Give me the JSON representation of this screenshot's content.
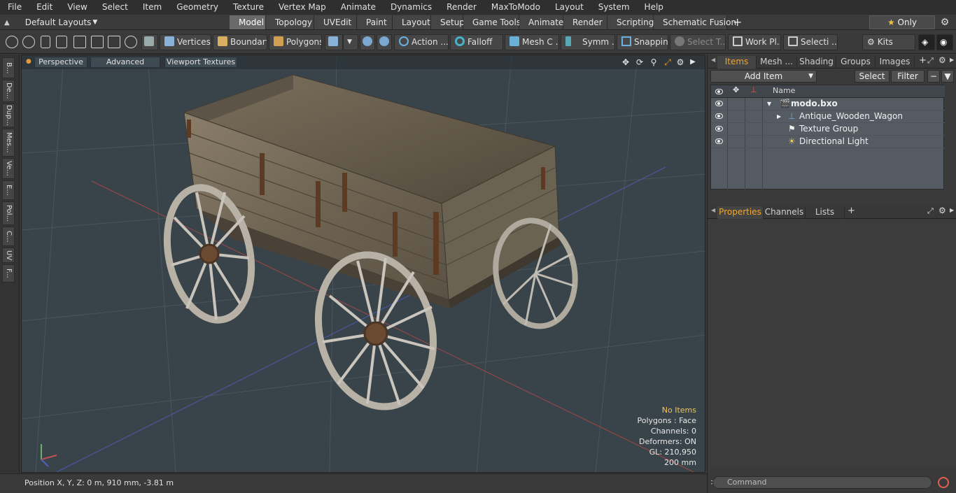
{
  "menu": [
    "File",
    "Edit",
    "View",
    "Select",
    "Item",
    "Geometry",
    "Texture",
    "Vertex Map",
    "Animate",
    "Dynamics",
    "Render",
    "MaxToModo",
    "Layout",
    "System",
    "Help"
  ],
  "layouts_label": "Default Layouts",
  "tabs": [
    "Model",
    "Topology",
    "UVEdit",
    "Paint",
    "Layout",
    "Setup",
    "Game Tools",
    "Animate",
    "Render",
    "Scripting",
    "Schematic Fusion"
  ],
  "tab_plus": "+",
  "only_label": "Only",
  "toolbar": {
    "vertices": "Vertices",
    "boundary": "Boundary",
    "polygons": "Polygons",
    "action": "Action",
    "falloff": "Falloff",
    "mesh": "Mesh C ...",
    "symm": "Symm ...",
    "snapping": "Snapping",
    "select_t": "Select T...",
    "work_pl": "Work Pl...",
    "selecti": "Selecti ...",
    "kits": "Kits"
  },
  "left_tabs": [
    "B...",
    "De...",
    "Dup...",
    "Mes...",
    "Ve...",
    "E...",
    "Pol...",
    "C...",
    "UV",
    "F..."
  ],
  "viewport": {
    "perspective": "Perspective",
    "advanced": "Advanced",
    "textures": "Viewport Textures",
    "stats": {
      "no_items": "No Items",
      "polygons": "Polygons : Face",
      "channels": "Channels: 0",
      "deformers": "Deformers: ON",
      "gl": "GL: 210,950",
      "scale": "200 mm"
    }
  },
  "status": {
    "position": "Position X, Y, Z:   0 m, 910 mm, -3.81 m"
  },
  "right_tabs_top": [
    "Items",
    "Mesh ...",
    "Shading",
    "Groups",
    "Images"
  ],
  "add_item": "Add Item",
  "select_btn": "Select",
  "filter_btn": "Filter",
  "items_header_name": "Name",
  "items": [
    {
      "name": "modo.bxo"
    },
    {
      "name": "Antique_Wooden_Wagon"
    },
    {
      "name": "Texture Group"
    },
    {
      "name": "Directional Light"
    }
  ],
  "right_tabs_bottom": [
    "Properties",
    "Channels",
    "Lists"
  ],
  "command_placeholder": "Command",
  "colors": {
    "accent": "#f4a62a",
    "viewport_bg": "#39434a"
  }
}
